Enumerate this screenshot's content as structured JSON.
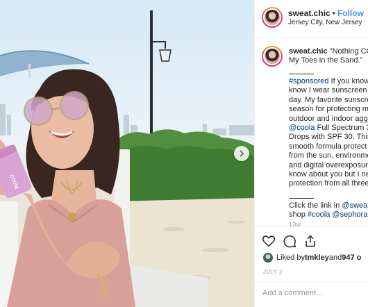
{
  "post": {
    "username": "sweat.chic",
    "separator": "•",
    "follow_label": "Follow",
    "location": "Jersey City, New Jersey"
  },
  "caption": {
    "username": "sweat.chic",
    "title_line1": "\"Nothing CO",
    "title_line2": "My Toes in the Sand.\"",
    "lines": [
      {
        "text": "#sponsored If you know",
        "hashtag": "#sponsored"
      },
      {
        "text": "know I wear sunscreen e"
      },
      {
        "text": "day. My favorite sunscre"
      },
      {
        "text": "season for protecting m"
      },
      {
        "text": "outdoor and indoor agg"
      },
      {
        "text": "@coola Full Spectrum 3",
        "mention": "@coola"
      },
      {
        "text": "Drops with SPF 30. This"
      },
      {
        "text": "smooth formula protect"
      },
      {
        "text": "from the sun, environme"
      },
      {
        "text": "and digital overexposur"
      },
      {
        "text": "know about you but I ne"
      },
      {
        "text": "protection from all three"
      }
    ],
    "link_line1_prefix": "Click the link in ",
    "link_line1_mention": "@sweat",
    "link_line2_prefix": "shop ",
    "link_line2_tag": "#coola",
    "link_line2_mention": "@sephora",
    "time_ago": "13w"
  },
  "actions": {
    "icons": [
      "heart-icon",
      "comment-icon",
      "share-icon"
    ],
    "liked_by_prefix": "Liked by ",
    "liked_by_user": "tmkley",
    "liked_by_and": " and ",
    "liked_by_count": "947 o",
    "date": "JULY 2",
    "comment_placeholder": "Add a comment..."
  },
  "colors": {
    "link": "#003569",
    "follow": "#3897f0",
    "muted": "#999999"
  }
}
